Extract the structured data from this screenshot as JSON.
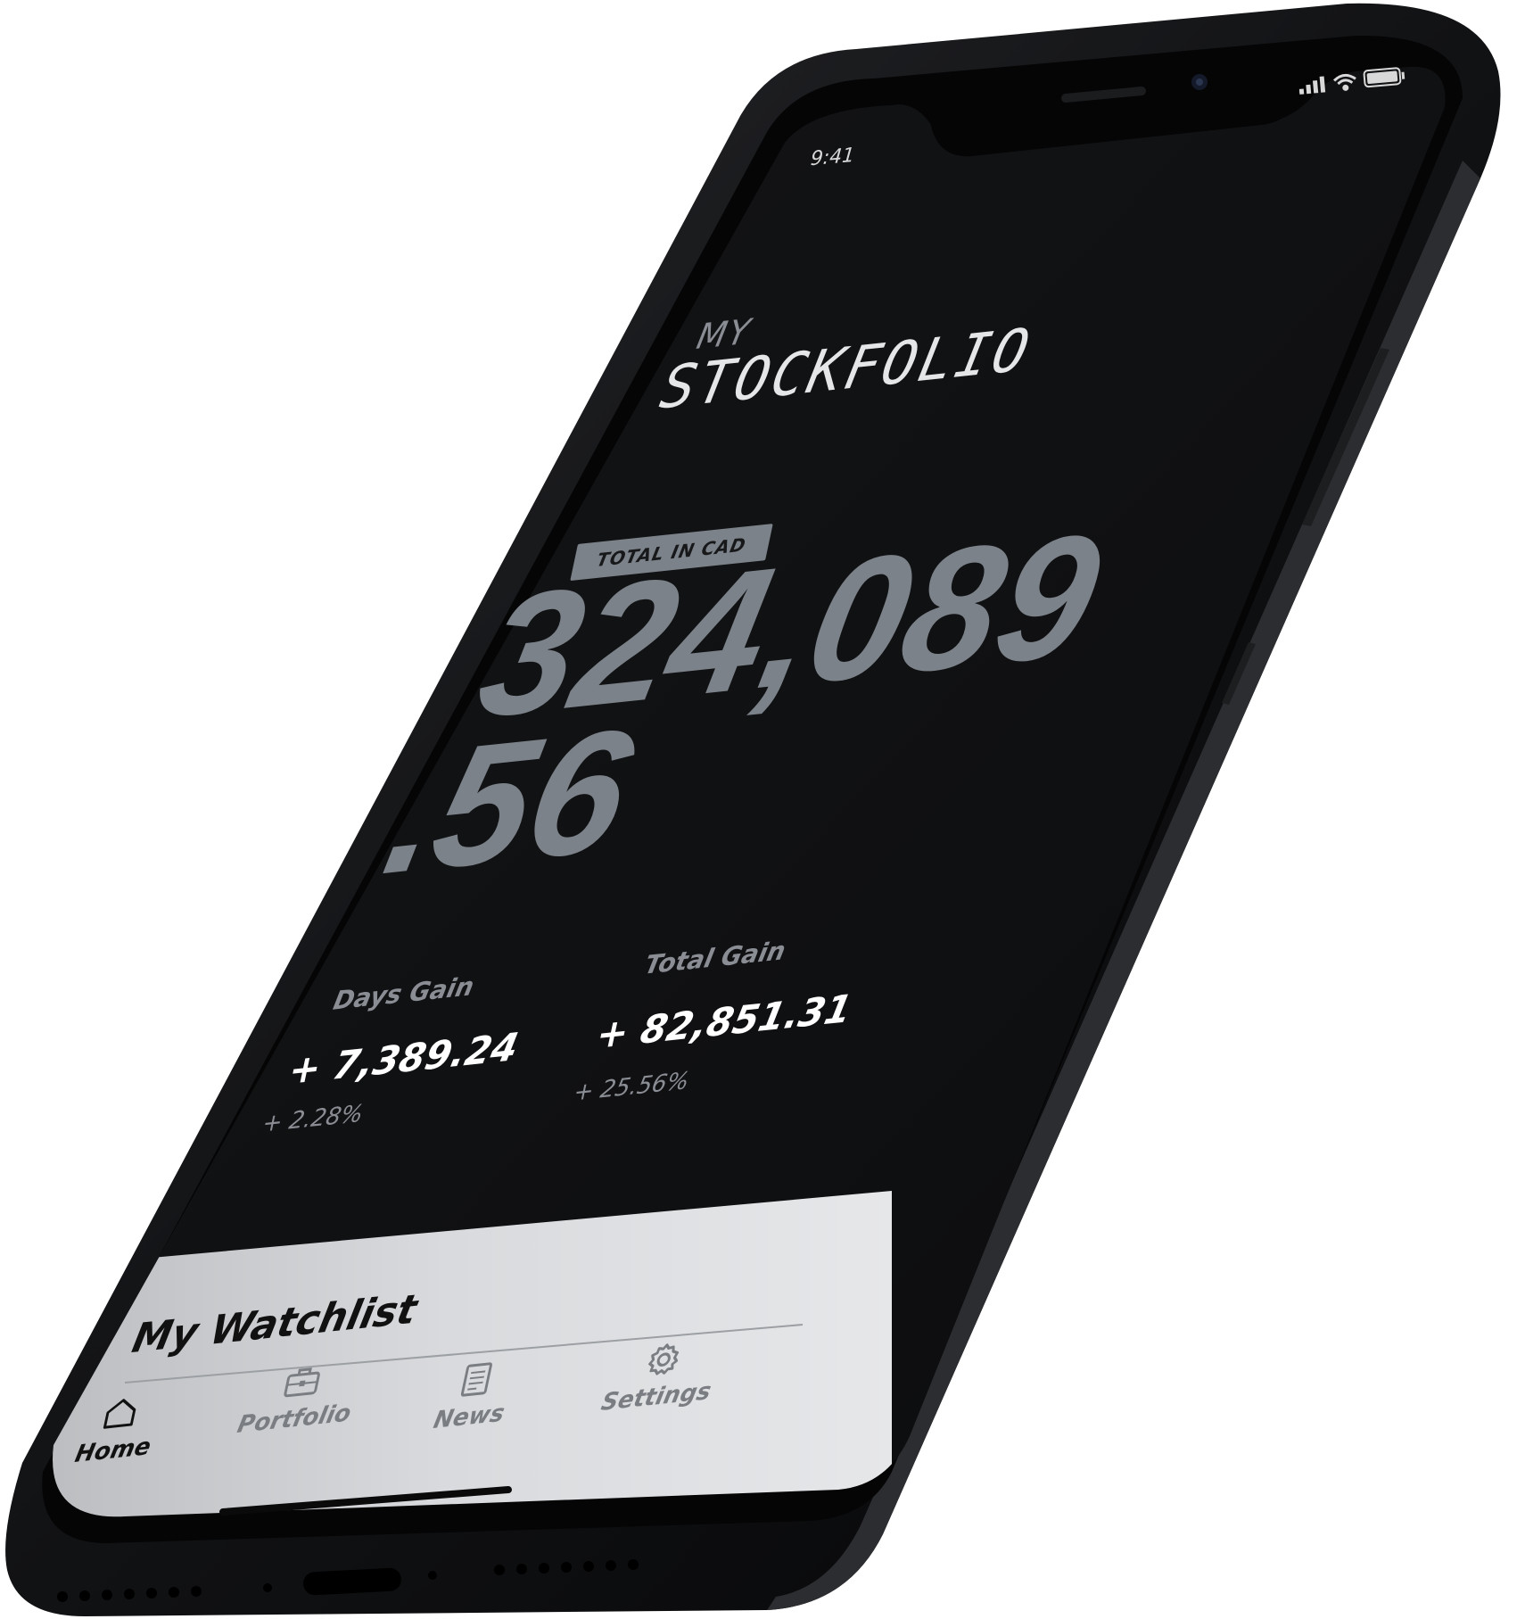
{
  "status_bar": {
    "time": "9:41",
    "signal_icon": "cellular-signal-icon",
    "wifi_icon": "wifi-icon",
    "battery_icon": "battery-icon"
  },
  "brand": {
    "prefix": "MY",
    "name": "STOCKFOLIO"
  },
  "portfolio": {
    "badge": "TOTAL IN CAD",
    "amount_whole": "324,089",
    "amount_cents": ".56"
  },
  "stats": {
    "days_gain": {
      "label": "Days Gain",
      "value": "+ 7,389.24",
      "percent": "+ 2.28%"
    },
    "total_gain": {
      "label": "Total Gain",
      "value": "+ 82,851.31",
      "percent": "+ 25.56%"
    }
  },
  "watchlist": {
    "title": "My Watchlist"
  },
  "tab_bar": {
    "tabs": [
      {
        "label": "Home",
        "icon": "home-icon",
        "active": true
      },
      {
        "label": "Portfolio",
        "icon": "briefcase-icon",
        "active": false
      },
      {
        "label": "News",
        "icon": "newspaper-icon",
        "active": false
      },
      {
        "label": "Settings",
        "icon": "gear-icon",
        "active": false
      }
    ]
  },
  "colors": {
    "screen_bg": "#0f1012",
    "accent_gray": "#7c8289",
    "text_white": "#ffffff",
    "panel_light": "#d4d6d9"
  }
}
